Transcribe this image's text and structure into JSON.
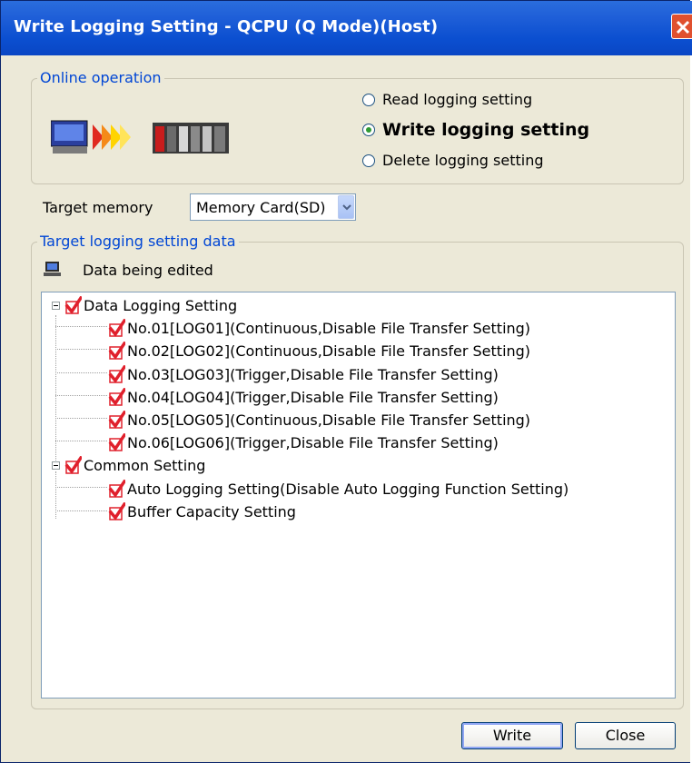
{
  "window": {
    "title": "Write Logging Setting - QCPU (Q Mode)(Host)"
  },
  "online_operation": {
    "group_label": "Online operation",
    "options": [
      {
        "label": "Read logging setting",
        "selected": false
      },
      {
        "label": "Write logging setting",
        "selected": true
      },
      {
        "label": "Delete logging setting",
        "selected": false
      }
    ]
  },
  "target_memory": {
    "label": "Target memory",
    "value": "Memory Card(SD)"
  },
  "target_data": {
    "group_label": "Target logging setting data",
    "source_label": "Data being edited",
    "tree": [
      {
        "label": "Data Logging Setting",
        "checked": true,
        "level": 0,
        "expanded": true
      },
      {
        "label": "No.01[LOG01](Continuous,Disable File Transfer Setting)",
        "checked": true,
        "level": 1
      },
      {
        "label": "No.02[LOG02](Continuous,Disable File Transfer Setting)",
        "checked": true,
        "level": 1
      },
      {
        "label": "No.03[LOG03](Trigger,Disable File Transfer Setting)",
        "checked": true,
        "level": 1
      },
      {
        "label": "No.04[LOG04](Trigger,Disable File Transfer Setting)",
        "checked": true,
        "level": 1
      },
      {
        "label": "No.05[LOG05](Continuous,Disable File Transfer Setting)",
        "checked": true,
        "level": 1
      },
      {
        "label": "No.06[LOG06](Trigger,Disable File Transfer Setting)",
        "checked": true,
        "level": 1
      },
      {
        "label": "Common Setting",
        "checked": true,
        "level": 0,
        "expanded": true
      },
      {
        "label": "Auto Logging Setting(Disable Auto Logging Function Setting)",
        "checked": true,
        "level": 1
      },
      {
        "label": "Buffer Capacity Setting",
        "checked": true,
        "level": 1
      }
    ]
  },
  "buttons": {
    "write": "Write",
    "close": "Close"
  },
  "icons": {
    "close": "close-icon",
    "radio": "radio-icon",
    "dropdown": "chevron-down-icon",
    "computer": "computer-icon",
    "checkbox": "checkmark-icon",
    "expander": "collapse-icon",
    "plc": "plc-transfer-illustration"
  },
  "colors": {
    "title_bar": "#0b4fd0",
    "group_label": "#0046d5",
    "check": "#e0202c",
    "radio_dot": "#2f9a34"
  }
}
